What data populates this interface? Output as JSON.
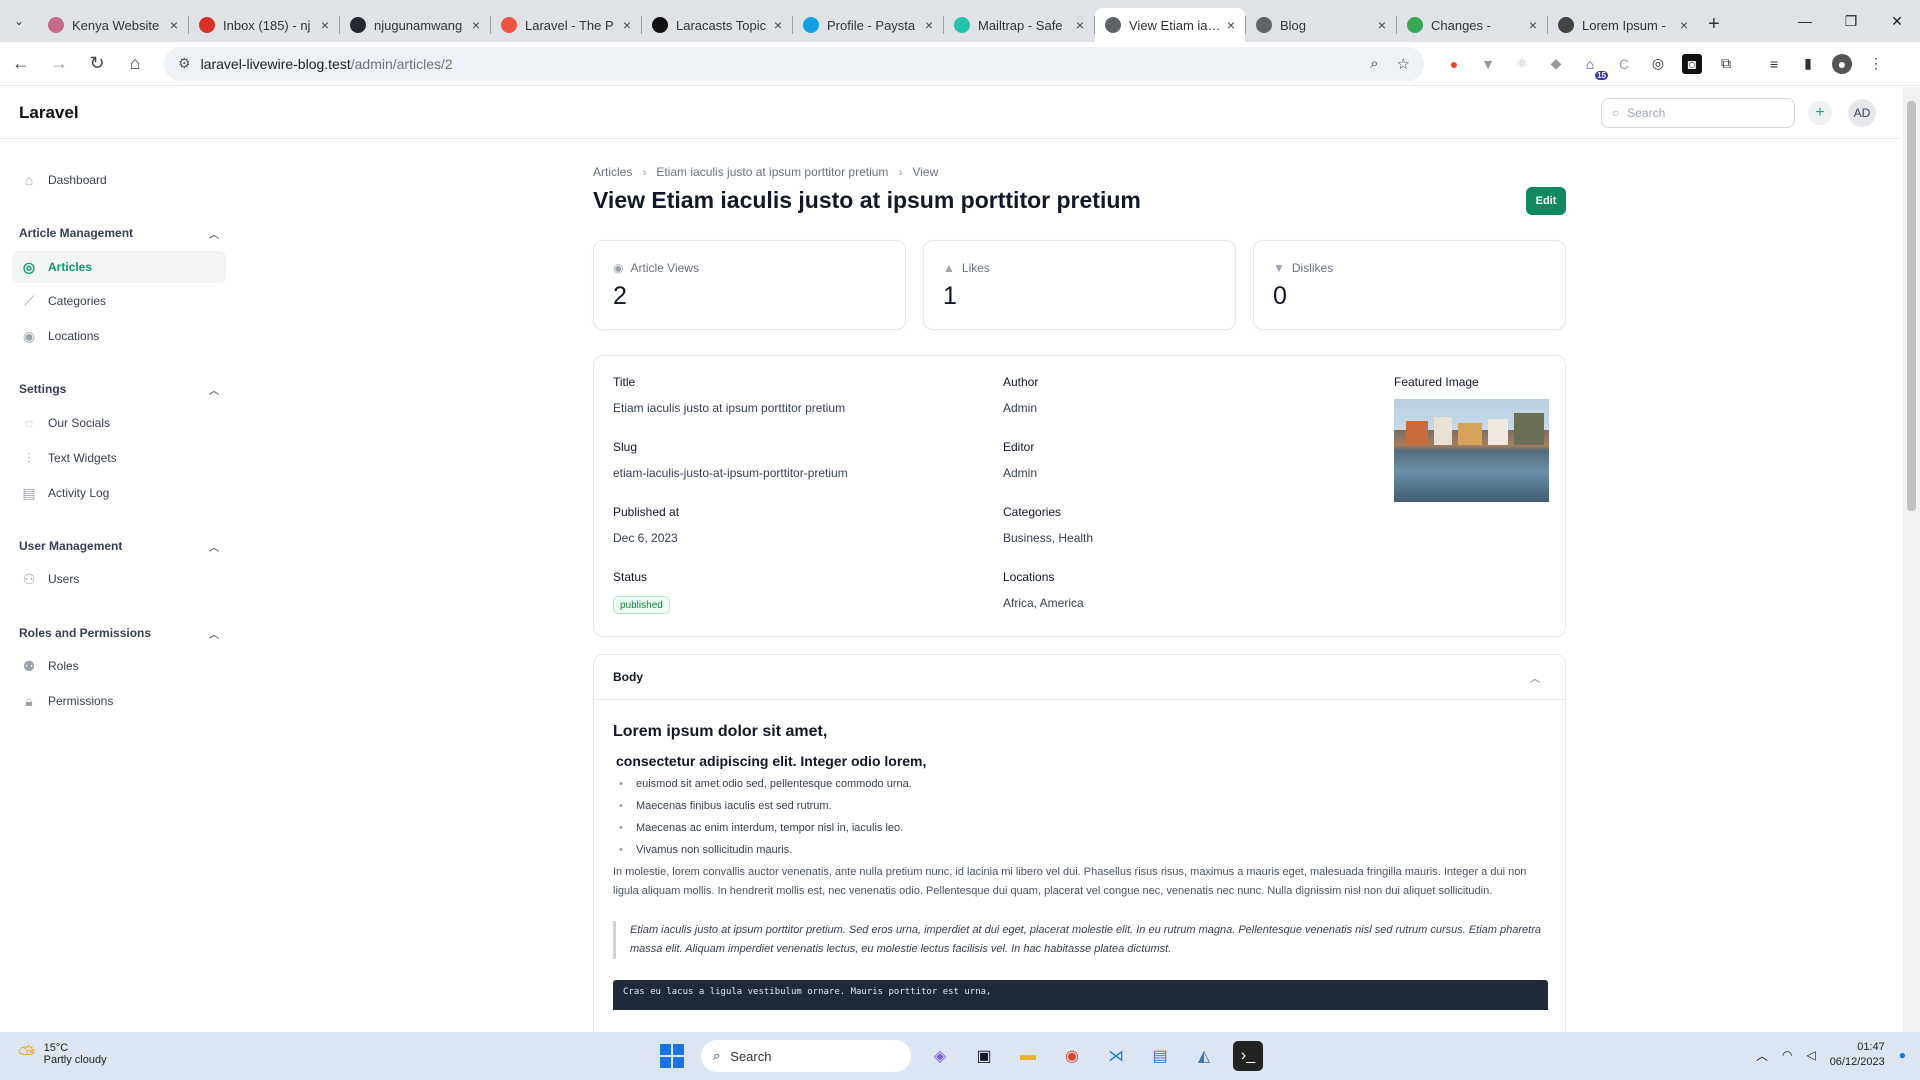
{
  "browser": {
    "tabs": [
      {
        "title": "Kenya Website",
        "color": "#c76a8a"
      },
      {
        "title": "Inbox (185) - nj",
        "color": "#d93025"
      },
      {
        "title": "njugunamwang",
        "color": "#24292f"
      },
      {
        "title": "Laravel - The P",
        "color": "#f05340"
      },
      {
        "title": "Laracasts Topic",
        "color": "#111111"
      },
      {
        "title": "Profile - Paysta",
        "color": "#0fa2e9"
      },
      {
        "title": "Mailtrap - Safe",
        "color": "#22c3a6"
      },
      {
        "title": "View Etiam iacu",
        "color": "#5f6368"
      },
      {
        "title": "Blog",
        "color": "#5f6368"
      },
      {
        "title": "Changes -",
        "color": "#34a853"
      },
      {
        "title": "Lorem Ipsum -",
        "color": "#444444"
      }
    ],
    "url_host": "laravel-livewire-blog.test",
    "url_path": "/admin/articles/2",
    "extension_badge": "15"
  },
  "app": {
    "brand": "Laravel",
    "search_placeholder": "Search",
    "avatar_initials": "AD"
  },
  "sidebar": {
    "dashboard": "Dashboard",
    "groups": {
      "article_management": "Article Management",
      "settings": "Settings",
      "user_management": "User Management",
      "roles_permissions": "Roles and Permissions"
    },
    "items": {
      "articles": "Articles",
      "categories": "Categories",
      "locations": "Locations",
      "our_socials": "Our Socials",
      "text_widgets": "Text Widgets",
      "activity_log": "Activity Log",
      "users": "Users",
      "roles": "Roles",
      "permissions": "Permissions"
    }
  },
  "breadcrumb": {
    "items": [
      "Articles",
      "Etiam iaculis justo at ipsum porttitor pretium",
      "View"
    ]
  },
  "page": {
    "title": "View Etiam iaculis justo at ipsum porttitor pretium",
    "edit_label": "Edit",
    "accent": "#0f8a5f"
  },
  "stats": [
    {
      "label": "Article Views",
      "value": "2",
      "icon": "eye-icon"
    },
    {
      "label": "Likes",
      "value": "1",
      "icon": "thumbs-up-icon"
    },
    {
      "label": "Dislikes",
      "value": "0",
      "icon": "thumbs-down-icon"
    }
  ],
  "article": {
    "title_label": "Title",
    "title": "Etiam iaculis justo at ipsum porttitor pretium",
    "slug_label": "Slug",
    "slug": "etiam-iaculis-justo-at-ipsum-porttitor-pretium",
    "published_label": "Published at",
    "published": "Dec 6, 2023",
    "status_label": "Status",
    "status": "published",
    "author_label": "Author",
    "author": "Admin",
    "editor_label": "Editor",
    "editor": "Admin",
    "categories_label": "Categories",
    "categories": "Business, Health",
    "locations_label": "Locations",
    "locations": "Africa, America",
    "featured_label": "Featured Image"
  },
  "body": {
    "section_label": "Body",
    "h1": "Lorem ipsum dolor sit amet,",
    "h2": "consectetur adipiscing elit. Integer odio lorem,",
    "list": [
      "euismod sit amet odio sed, pellentesque commodo urna.",
      "Maecenas finibus iaculis est sed rutrum.",
      "Maecenas ac enim interdum, tempor nisl in, iaculis leo.",
      "Vivamus non sollicitudin mauris."
    ],
    "paragraph": "In molestie, lorem convallis auctor venenatis, ante nulla pretium nunc, id lacinia mi libero vel dui. Phasellus risus risus, maximus a mauris eget, malesuada fringilla mauris. Integer a dui non ligula aliquam mollis. In hendrerit mollis est, nec venenatis odio. Pellentesque dui quam, placerat vel congue nec, venenatis nec nunc. Nulla dignissim nisl non dui aliquet sollicitudin.",
    "quote": "Etiam iaculis justo at ipsum porttitor pretium. Sed eros urna, imperdiet at dui eget, placerat molestie elit. In eu rutrum magna. Pellentesque venenatis nisl sed rutrum cursus. Etiam pharetra massa elit. Aliquam imperdiet venenatis lectus, eu molestie lectus facilisis vel. In hac habitasse platea dictumst.",
    "code": "Cras eu lacus a ligula vestibulum ornare. Mauris porttitor est urna,"
  },
  "taskbar": {
    "temp": "15°C",
    "weather": "Partly cloudy",
    "search": "Search",
    "time": "01:47",
    "date": "06/12/2023"
  }
}
